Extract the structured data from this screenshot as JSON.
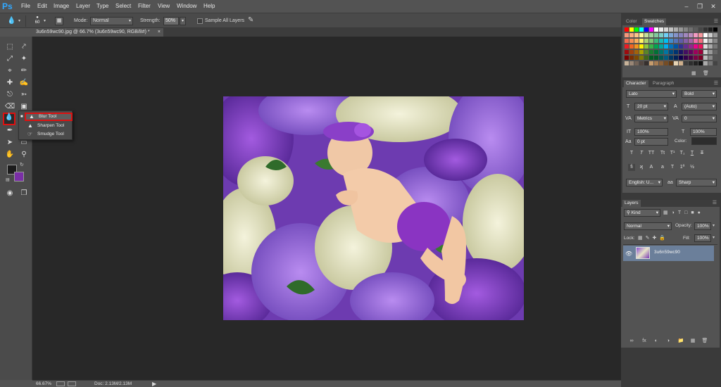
{
  "app": {
    "logo": "Ps"
  },
  "menu": [
    "File",
    "Edit",
    "Image",
    "Layer",
    "Type",
    "Select",
    "Filter",
    "View",
    "Window",
    "Help"
  ],
  "options": {
    "brush_size": "60",
    "mode_label": "Mode:",
    "mode_value": "Normal",
    "strength_label": "Strength:",
    "strength_value": "50%",
    "sample_all_layers": "Sample All Layers"
  },
  "document": {
    "tab_title": "3u6n59wc90.jpg @ 66.7% (3u6n59wc90, RGB/8#) *",
    "close": "×"
  },
  "flyout": {
    "items": [
      {
        "label": "Blur Tool",
        "icon": "blur-drop-icon"
      },
      {
        "label": "Sharpen Tool",
        "icon": "sharpen-triangle-icon"
      },
      {
        "label": "Smudge Tool",
        "icon": "smudge-finger-icon"
      }
    ]
  },
  "status": {
    "zoom": "66.67%",
    "doc_size": "Doc: 2.13M/2.13M"
  },
  "color_panel": {
    "tabs": [
      "Color",
      "Swatches"
    ],
    "active_tab": "Swatches"
  },
  "character_panel": {
    "tabs": [
      "Character",
      "Paragraph"
    ],
    "font_family": "Lato",
    "font_style": "Bold",
    "font_size": "20 pt",
    "leading": "(Auto)",
    "kerning": "Metrics",
    "tracking": "0",
    "vertical_scale": "100%",
    "horizontal_scale": "100%",
    "baseline_shift": "0 pt",
    "color_label": "Color:",
    "language": "English: U...",
    "anti_alias": "Sharp",
    "aa_label": "aa"
  },
  "layers_panel": {
    "tab": "Layers",
    "filter_kind": "Kind",
    "blend_mode": "Normal",
    "opacity_label": "Opacity:",
    "opacity_value": "100%",
    "lock_label": "Lock:",
    "fill_label": "Fill:",
    "fill_value": "100%",
    "layers": [
      {
        "name": "3u6n59wc90"
      }
    ]
  },
  "colors": {
    "foreground": "#1c1c1c",
    "background": "#7a2fa6",
    "selected_layer": "#6b7f9a",
    "highlight_border": "#dd1111",
    "canvas_bg": "#282828",
    "brand": "#31a8ff"
  }
}
